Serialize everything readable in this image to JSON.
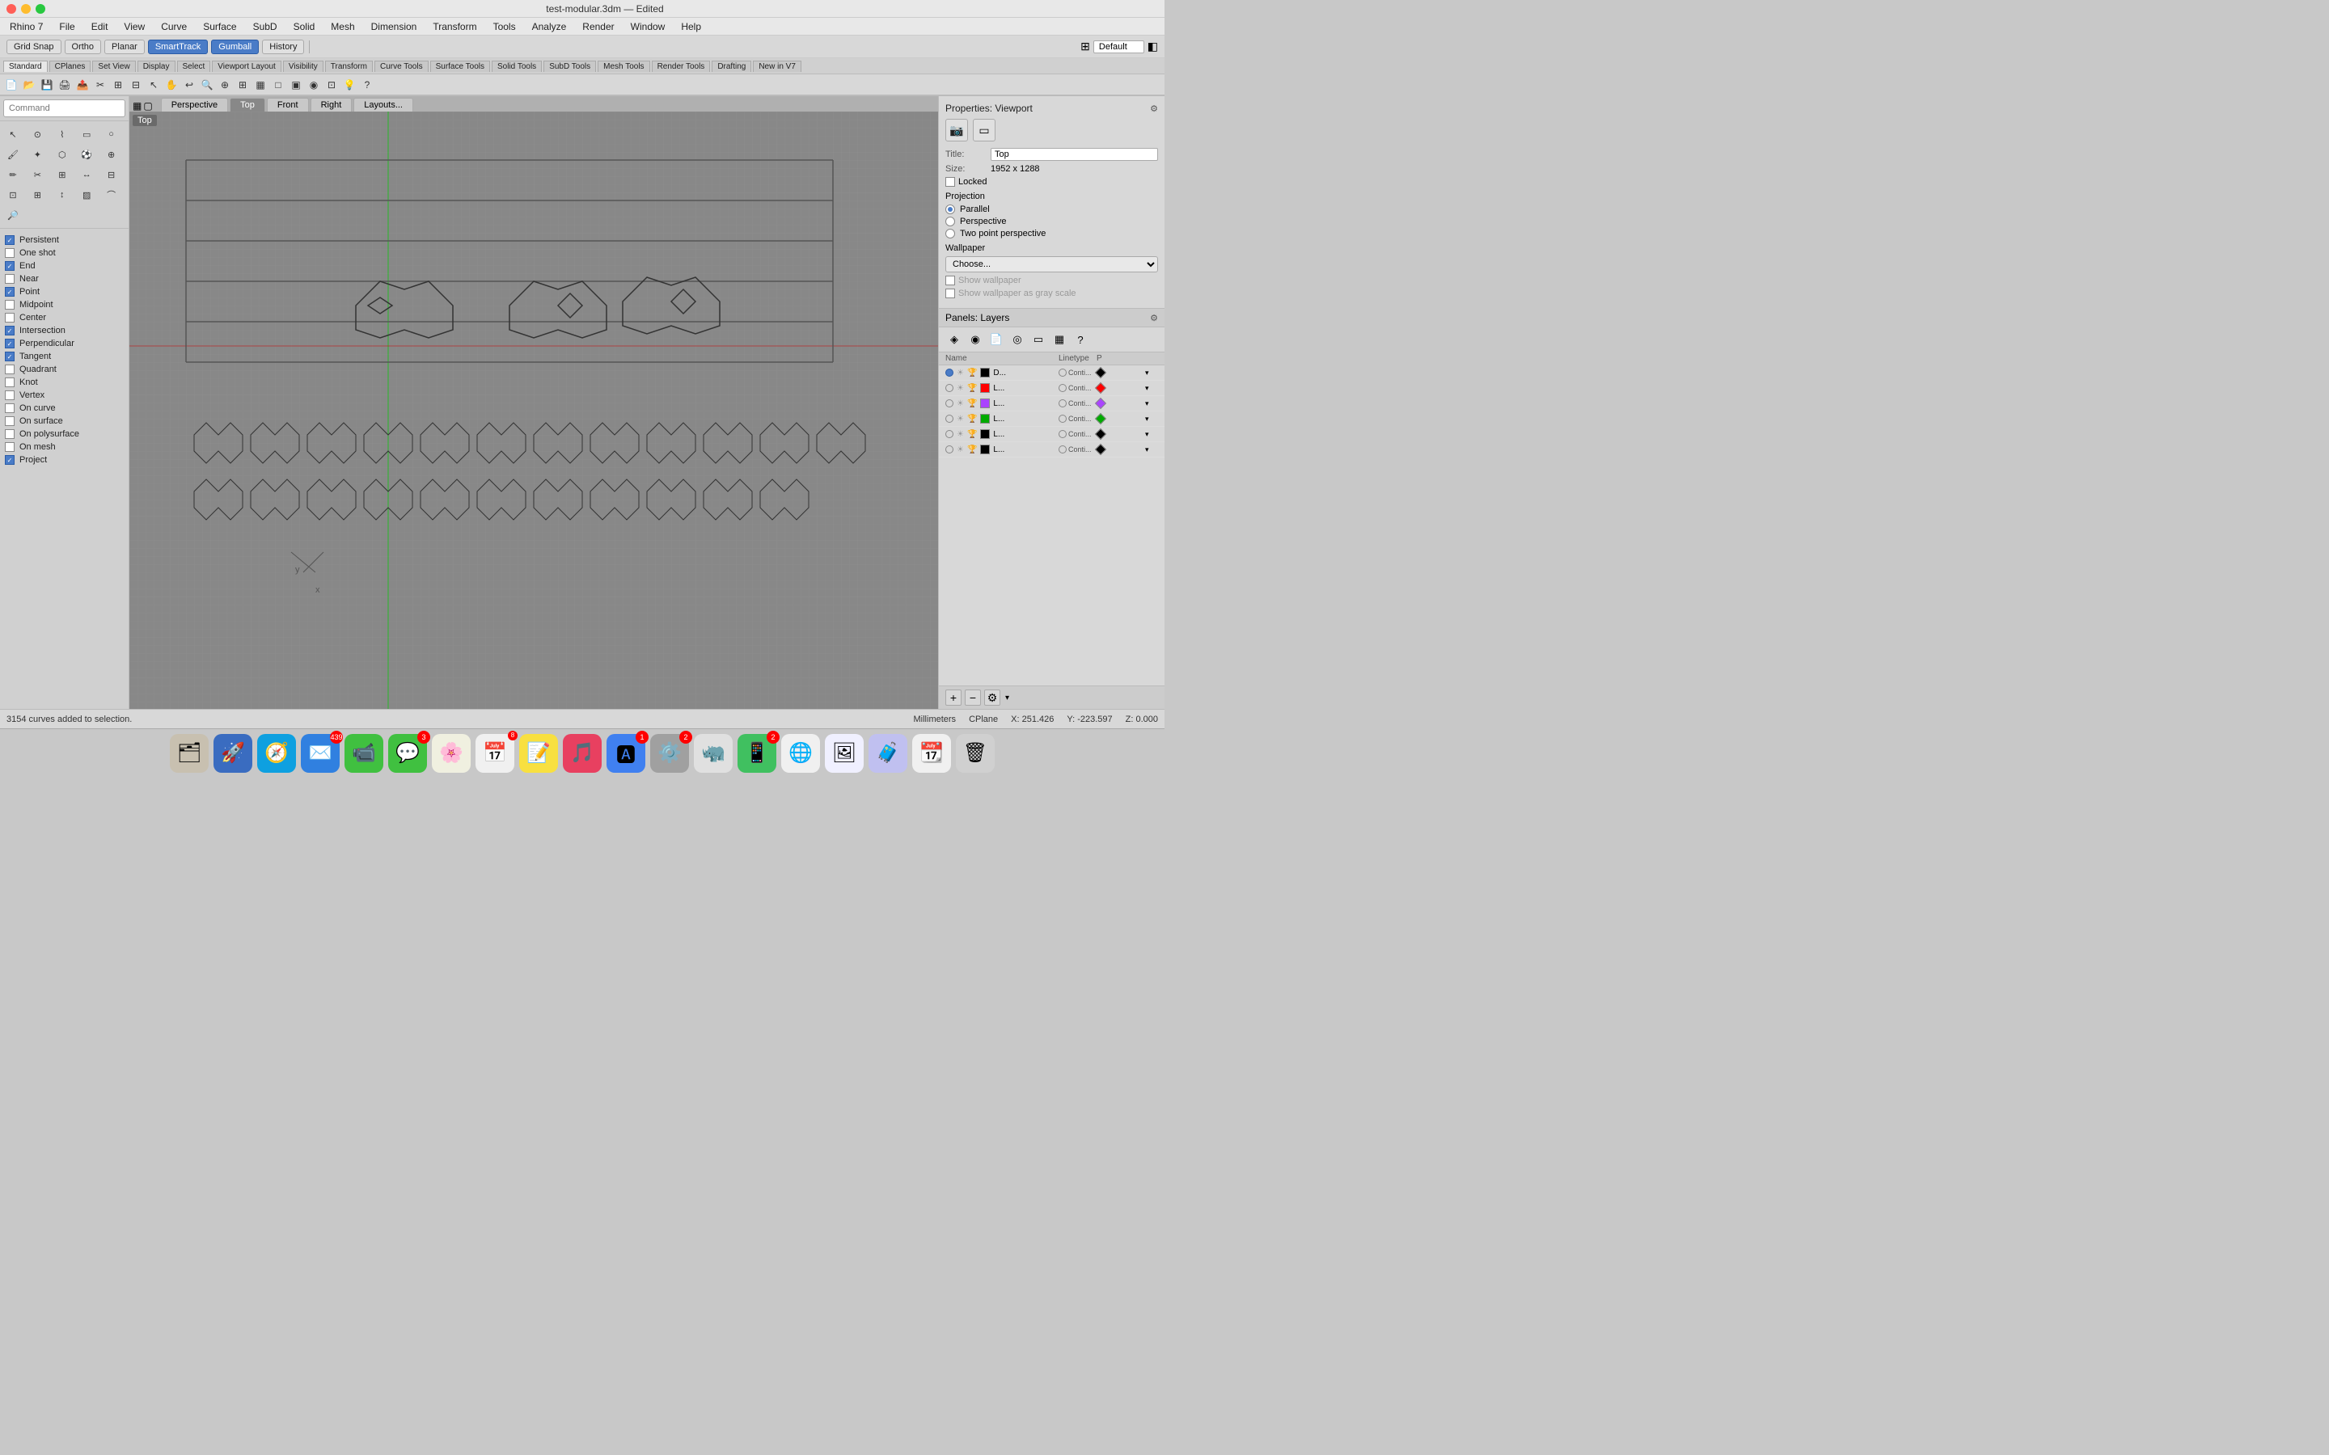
{
  "app": {
    "title": "Rhino 7",
    "file": "test-modular.3dm — Edited"
  },
  "menubar": {
    "items": [
      "Rhino 7",
      "File",
      "Edit",
      "View",
      "Curve",
      "Surface",
      "SubD",
      "Solid",
      "Mesh",
      "Dimension",
      "Transform",
      "Tools",
      "Analyze",
      "Render",
      "Window",
      "Help"
    ]
  },
  "snap_toolbar": {
    "grid_snap": "Grid Snap",
    "ortho": "Ortho",
    "planar": "Planar",
    "smart_track": "SmartTrack",
    "gumball": "Gumball",
    "history": "History"
  },
  "tab_toolbar": {
    "tabs": [
      "Standard",
      "CPlanes",
      "Set View",
      "Display",
      "Select",
      "Viewport Layout",
      "Visibility",
      "Transform",
      "Curve Tools",
      "Surface Tools",
      "Solid Tools",
      "SubD Tools",
      "Mesh Tools",
      "Render Tools",
      "Drafting",
      "New in V7"
    ]
  },
  "viewport": {
    "tabs": [
      "Perspective",
      "Top",
      "Front",
      "Right",
      "Layouts..."
    ],
    "active_tab": "Top",
    "label": "Top"
  },
  "command": {
    "placeholder": "Command",
    "status": "3154 curves added to selection."
  },
  "properties": {
    "panel_title": "Properties: Viewport",
    "title_label": "Title:",
    "title_value": "Top",
    "size_label": "Size:",
    "size_value": "1952 x 1288",
    "locked_label": "Locked",
    "projection_title": "Projection",
    "projections": [
      "Parallel",
      "Perspective",
      "Two point perspective"
    ],
    "active_projection": "Parallel",
    "wallpaper_title": "Wallpaper",
    "wallpaper_choose": "Choose...",
    "show_wallpaper": "Show wallpaper",
    "show_grayscale": "Show wallpaper as gray scale"
  },
  "layers": {
    "panel_title": "Panels: Layers",
    "columns": [
      "Name",
      "Linetype",
      "P"
    ],
    "rows": [
      {
        "name": "D...",
        "active": true,
        "color": "#000000",
        "linetype": "Conti...",
        "p_color": "#000000"
      },
      {
        "name": "L...",
        "active": false,
        "color": "#ff0000",
        "linetype": "Conti...",
        "p_color": "#ff0000"
      },
      {
        "name": "L...",
        "active": false,
        "color": "#aa44ff",
        "linetype": "Conti...",
        "p_color": "#aa44ff"
      },
      {
        "name": "L...",
        "active": false,
        "color": "#00aa00",
        "linetype": "Conti...",
        "p_color": "#00aa00"
      },
      {
        "name": "L...",
        "active": false,
        "color": "#000000",
        "linetype": "Conti...",
        "p_color": "#000000"
      },
      {
        "name": "L...",
        "active": false,
        "color": "#000000",
        "linetype": "Conti...",
        "p_color": "#000000"
      }
    ]
  },
  "statusbar": {
    "status_text": "3154 curves added to selection.",
    "units": "Millimeters",
    "cplane": "CPlane",
    "x": "X: 251.426",
    "y": "Y: -223.597",
    "z": "Z: 0.000"
  },
  "snap_panel": {
    "items": [
      {
        "label": "Persistent",
        "checked": true
      },
      {
        "label": "One shot",
        "checked": false
      },
      {
        "label": "End",
        "checked": true
      },
      {
        "label": "Near",
        "checked": false
      },
      {
        "label": "Point",
        "checked": true
      },
      {
        "label": "Midpoint",
        "checked": false
      },
      {
        "label": "Center",
        "checked": false
      },
      {
        "label": "Intersection",
        "checked": true
      },
      {
        "label": "Perpendicular",
        "checked": true
      },
      {
        "label": "Tangent",
        "checked": true
      },
      {
        "label": "Quadrant",
        "checked": false
      },
      {
        "label": "Knot",
        "checked": false
      },
      {
        "label": "Vertex",
        "checked": false
      },
      {
        "label": "On curve",
        "checked": false
      },
      {
        "label": "On surface",
        "checked": false
      },
      {
        "label": "On polysurface",
        "checked": false
      },
      {
        "label": "On mesh",
        "checked": false
      },
      {
        "label": "Project",
        "checked": true
      }
    ]
  },
  "dock": {
    "icons": [
      {
        "name": "finder",
        "emoji": "🗂",
        "badge": null
      },
      {
        "name": "launchpad",
        "emoji": "🚀",
        "badge": null
      },
      {
        "name": "safari",
        "emoji": "🧭",
        "badge": null
      },
      {
        "name": "mail",
        "emoji": "✉️",
        "badge": "439"
      },
      {
        "name": "facetime",
        "emoji": "📹",
        "badge": null
      },
      {
        "name": "messages",
        "emoji": "💬",
        "badge": "3"
      },
      {
        "name": "photos",
        "emoji": "🌸",
        "badge": null
      },
      {
        "name": "calendar",
        "emoji": "📅",
        "badge": null
      },
      {
        "name": "notes",
        "emoji": "📝",
        "badge": null
      },
      {
        "name": "music",
        "emoji": "🎵",
        "badge": null
      },
      {
        "name": "appstore",
        "emoji": "🅰",
        "badge": "1"
      },
      {
        "name": "settings",
        "emoji": "⚙️",
        "badge": "2"
      },
      {
        "name": "rhino",
        "emoji": "🦏",
        "badge": null
      },
      {
        "name": "whatsapp",
        "emoji": "📱",
        "badge": "2"
      },
      {
        "name": "chrome",
        "emoji": "🌐",
        "badge": null
      },
      {
        "name": "preview",
        "emoji": "🖼",
        "badge": null
      },
      {
        "name": "suitcase",
        "emoji": "🧳",
        "badge": null
      },
      {
        "name": "calendar2",
        "emoji": "📆",
        "badge": null
      },
      {
        "name": "trash",
        "emoji": "🗑",
        "badge": null
      }
    ]
  }
}
